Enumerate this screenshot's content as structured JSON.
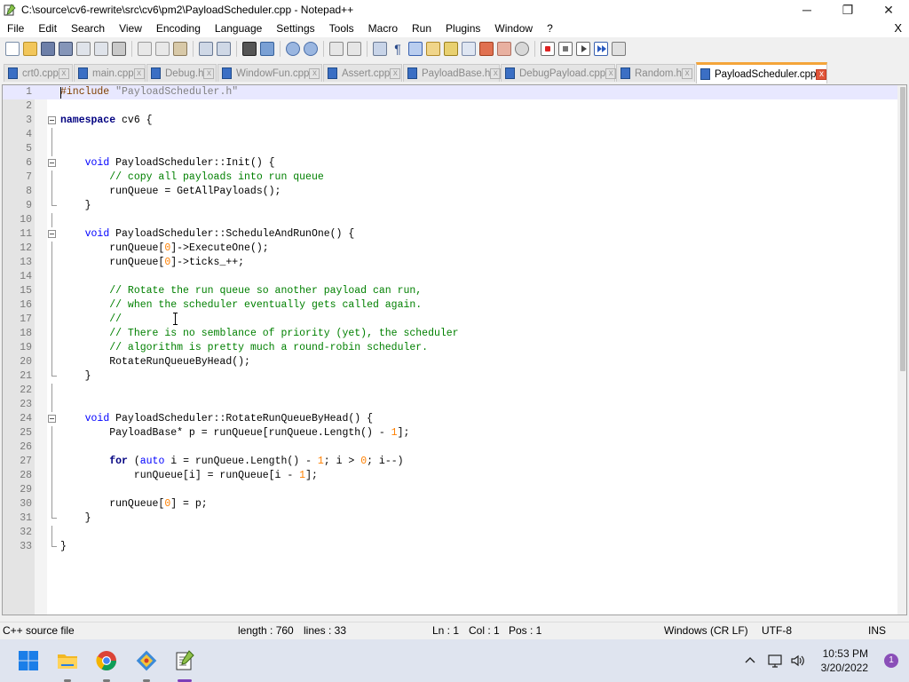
{
  "window": {
    "title": "C:\\source\\cv6-rewrite\\src\\cv6\\pm2\\PayloadScheduler.cpp - Notepad++",
    "minimize": "─",
    "maximize": "❐",
    "close": "✕"
  },
  "menu": {
    "items": [
      "File",
      "Edit",
      "Search",
      "View",
      "Encoding",
      "Language",
      "Settings",
      "Tools",
      "Macro",
      "Run",
      "Plugins",
      "Window",
      "?"
    ],
    "close_doc": "X"
  },
  "toolbar": {
    "icons": [
      "new-file-icon",
      "open-file-icon",
      "save-icon",
      "save-all-icon",
      "close-icon",
      "close-all-icon",
      "print-icon",
      "cut-icon",
      "copy-icon",
      "paste-icon",
      "undo-icon",
      "redo-icon",
      "find-icon",
      "replace-icon",
      "zoom-in-icon",
      "zoom-out-icon",
      "sync-vertical-icon",
      "sync-horizontal-icon",
      "word-wrap-icon",
      "show-all-chars-icon",
      "indent-guide-icon",
      "udl-icon",
      "doc-map-icon",
      "doc-list-icon",
      "function-list-icon",
      "folder-workspace-icon",
      "monitoring-icon",
      "record-macro-icon",
      "stop-record-icon",
      "play-macro-icon",
      "run-macro-multiple-icon",
      "save-macro-icon"
    ]
  },
  "tabs": [
    {
      "label": "crt0.cpp",
      "close": "x",
      "active": false
    },
    {
      "label": "main.cpp",
      "close": "x",
      "active": false
    },
    {
      "label": "Debug.h",
      "close": "x",
      "active": false
    },
    {
      "label": "WindowFun.cpp",
      "close": "x",
      "active": false
    },
    {
      "label": "Assert.cpp",
      "close": "x",
      "active": false
    },
    {
      "label": "PayloadBase.h",
      "close": "x",
      "active": false
    },
    {
      "label": "DebugPayload.cpp",
      "close": "x",
      "active": false
    },
    {
      "label": "Random.h",
      "close": "x",
      "active": false
    },
    {
      "label": "PayloadScheduler.cpp",
      "close": "x",
      "active": true
    }
  ],
  "editor": {
    "lines": [
      {
        "n": "1",
        "text": "#include \"PayloadScheduler.h\""
      },
      {
        "n": "2",
        "text": ""
      },
      {
        "n": "3",
        "text": "namespace cv6 {"
      },
      {
        "n": "4",
        "text": ""
      },
      {
        "n": "5",
        "text": ""
      },
      {
        "n": "6",
        "text": "    void PayloadScheduler::Init() {"
      },
      {
        "n": "7",
        "text": "        // copy all payloads into run queue"
      },
      {
        "n": "8",
        "text": "        runQueue = GetAllPayloads();"
      },
      {
        "n": "9",
        "text": "    }"
      },
      {
        "n": "10",
        "text": ""
      },
      {
        "n": "11",
        "text": "    void PayloadScheduler::ScheduleAndRunOne() {"
      },
      {
        "n": "12",
        "text": "        runQueue[0]->ExecuteOne();"
      },
      {
        "n": "13",
        "text": "        runQueue[0]->ticks_++;"
      },
      {
        "n": "14",
        "text": ""
      },
      {
        "n": "15",
        "text": "        // Rotate the run queue so another payload can run,"
      },
      {
        "n": "16",
        "text": "        // when the scheduler eventually gets called again."
      },
      {
        "n": "17",
        "text": "        //"
      },
      {
        "n": "18",
        "text": "        // There is no semblance of priority (yet), the scheduler"
      },
      {
        "n": "19",
        "text": "        // algorithm is pretty much a round-robin scheduler."
      },
      {
        "n": "20",
        "text": "        RotateRunQueueByHead();"
      },
      {
        "n": "21",
        "text": "    }"
      },
      {
        "n": "22",
        "text": ""
      },
      {
        "n": "23",
        "text": ""
      },
      {
        "n": "24",
        "text": "    void PayloadScheduler::RotateRunQueueByHead() {"
      },
      {
        "n": "25",
        "text": "        PayloadBase* p = runQueue[runQueue.Length() - 1];"
      },
      {
        "n": "26",
        "text": ""
      },
      {
        "n": "27",
        "text": "        for (auto i = runQueue.Length() - 1; i > 0; i--)"
      },
      {
        "n": "28",
        "text": "            runQueue[i] = runQueue[i - 1];"
      },
      {
        "n": "29",
        "text": ""
      },
      {
        "n": "30",
        "text": "        runQueue[0] = p;"
      },
      {
        "n": "31",
        "text": "    }"
      },
      {
        "n": "32",
        "text": ""
      },
      {
        "n": "33",
        "text": "}"
      }
    ]
  },
  "status": {
    "file_type": "C++ source file",
    "length": "length : 760",
    "lines": "lines : 33",
    "ln": "Ln : 1",
    "col": "Col : 1",
    "pos": "Pos : 1",
    "eol": "Windows (CR LF)",
    "encoding": "UTF-8",
    "mode": "INS"
  },
  "taskbar": {
    "apps": [
      "windows-start-icon",
      "file-explorer-icon",
      "chrome-icon",
      "git-icon",
      "notepadpp-icon"
    ],
    "time": "10:53 PM",
    "date": "3/20/2022",
    "notifications": "1"
  },
  "colors": {
    "active_tab_accent": "#f4a53a",
    "keyword": "#0000ff",
    "comment": "#008000",
    "number": "#ff8000",
    "string": "#808080",
    "preprocessor": "#804000"
  }
}
